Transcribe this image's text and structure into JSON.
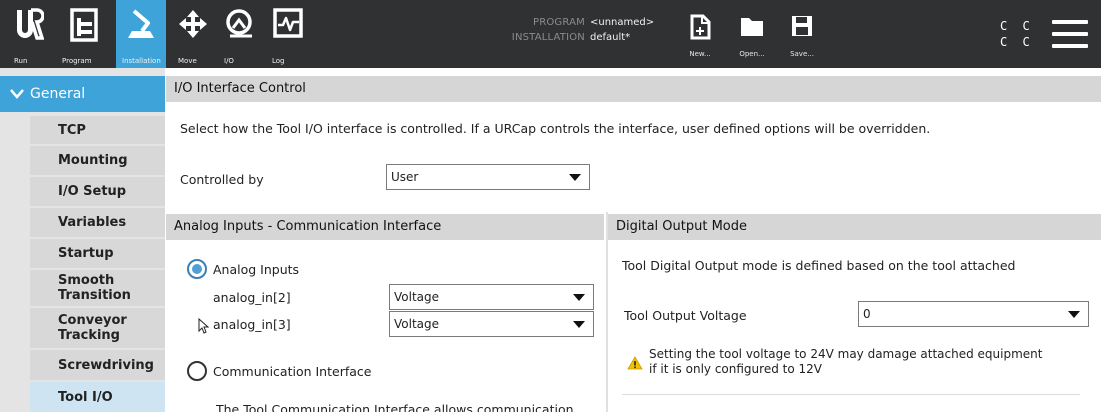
{
  "nav": {
    "run": "Run",
    "program": "Program",
    "installation": "Installation",
    "move": "Move",
    "io": "I/O",
    "log": "Log"
  },
  "program_info": {
    "program_key": "PROGRAM",
    "program_value": "<unnamed>",
    "installation_key": "INSTALLATION",
    "installation_value": "default*"
  },
  "file": {
    "new": "New...",
    "open": "Open...",
    "save": "Save..."
  },
  "speed": {
    "line1": "C C",
    "line2": "C C"
  },
  "sidebar": {
    "general": "General",
    "items": [
      {
        "label": "TCP"
      },
      {
        "label": "Mounting"
      },
      {
        "label": "I/O Setup"
      },
      {
        "label": "Variables"
      },
      {
        "label": "Startup"
      },
      {
        "label": "Smooth Transition"
      },
      {
        "label": "Conveyor Tracking"
      },
      {
        "label": "Screwdriving"
      },
      {
        "label": "Tool I/O"
      }
    ]
  },
  "main": {
    "title": "I/O Interface Control",
    "description": "Select how the Tool I/O interface is controlled. If a URCap controls the interface, user defined options will be overridden.",
    "controlled_by_label": "Controlled by",
    "controlled_by_value": "User",
    "analog": {
      "header": "Analog Inputs - Communication Interface",
      "analog_inputs_label": "Analog Inputs",
      "analog_in2_label": "analog_in[2]",
      "analog_in2_value": "Voltage",
      "analog_in3_label": "analog_in[3]",
      "analog_in3_value": "Voltage",
      "comm_label": "Communication Interface",
      "comm_desc": "The Tool Communication Interface allows communication"
    },
    "digital": {
      "header": "Digital Output Mode",
      "desc": "Tool Digital Output mode is defined based on the tool attached",
      "voltage_label": "Tool Output Voltage",
      "voltage_value": "0",
      "warning_line1": "Setting the tool voltage to 24V may damage attached equipment",
      "warning_line2": "if it is only configured to 12V"
    }
  }
}
